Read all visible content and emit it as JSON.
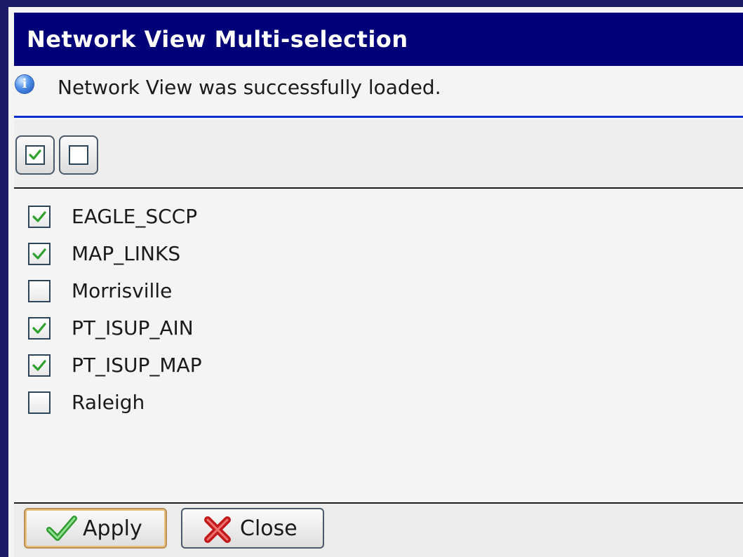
{
  "window": {
    "title": "Network View Multi-selection"
  },
  "info": {
    "icon": "info-icon",
    "message": "Network View was successfully loaded."
  },
  "toolbar": {
    "select_all_icon": "checked-box-icon",
    "deselect_all_icon": "empty-box-icon"
  },
  "items": [
    {
      "label": "EAGLE_SCCP",
      "checked": true
    },
    {
      "label": "MAP_LINKS",
      "checked": true
    },
    {
      "label": "Morrisville",
      "checked": false
    },
    {
      "label": "PT_ISUP_AIN",
      "checked": true
    },
    {
      "label": "PT_ISUP_MAP",
      "checked": true
    },
    {
      "label": "Raleigh",
      "checked": false
    }
  ],
  "buttons": {
    "apply_label": "Apply",
    "apply_icon": "green-check-icon",
    "close_label": "Close",
    "close_icon": "red-x-icon"
  },
  "colors": {
    "titlebar": "#000078",
    "accent_border": "#0a2fcf",
    "check": "#2ea02e"
  }
}
